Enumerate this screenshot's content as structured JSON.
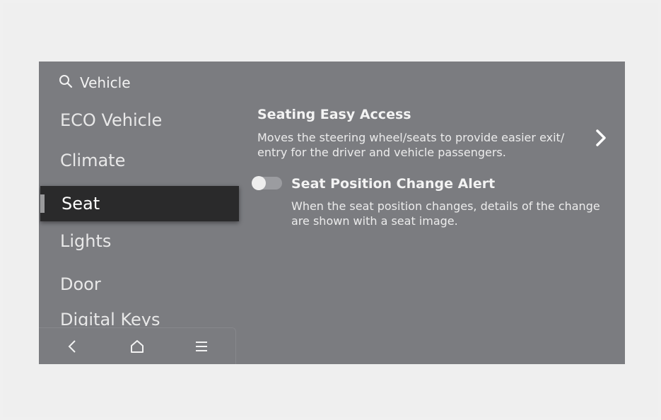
{
  "header": {
    "search_label": "Vehicle"
  },
  "sidebar": {
    "items": [
      {
        "label": "ECO Vehicle"
      },
      {
        "label": "Climate"
      },
      {
        "label": "Seat"
      },
      {
        "label": "Lights"
      },
      {
        "label": "Door"
      },
      {
        "label": "Digital Keys"
      }
    ],
    "active_item": "Seat"
  },
  "settings": {
    "seating_easy_access": {
      "title": "Seating Easy Access",
      "description_line1": "Moves the steering wheel/seats to provide easier exit/",
      "description_line2": "entry for the driver and vehicle passengers."
    },
    "seat_position_change_alert": {
      "title": "Seat Position Change Alert",
      "description_line1": "When the seat position changes, details of the change",
      "description_line2": "are shown with a seat image.",
      "toggle_on": false
    }
  },
  "navbar": {
    "buttons": [
      "back-icon",
      "home-icon",
      "menu-icon"
    ]
  },
  "colors": {
    "screen_bg": "#7b7c80",
    "active_item_bg": "#2a2a2b",
    "text": "#f3f3f3"
  }
}
